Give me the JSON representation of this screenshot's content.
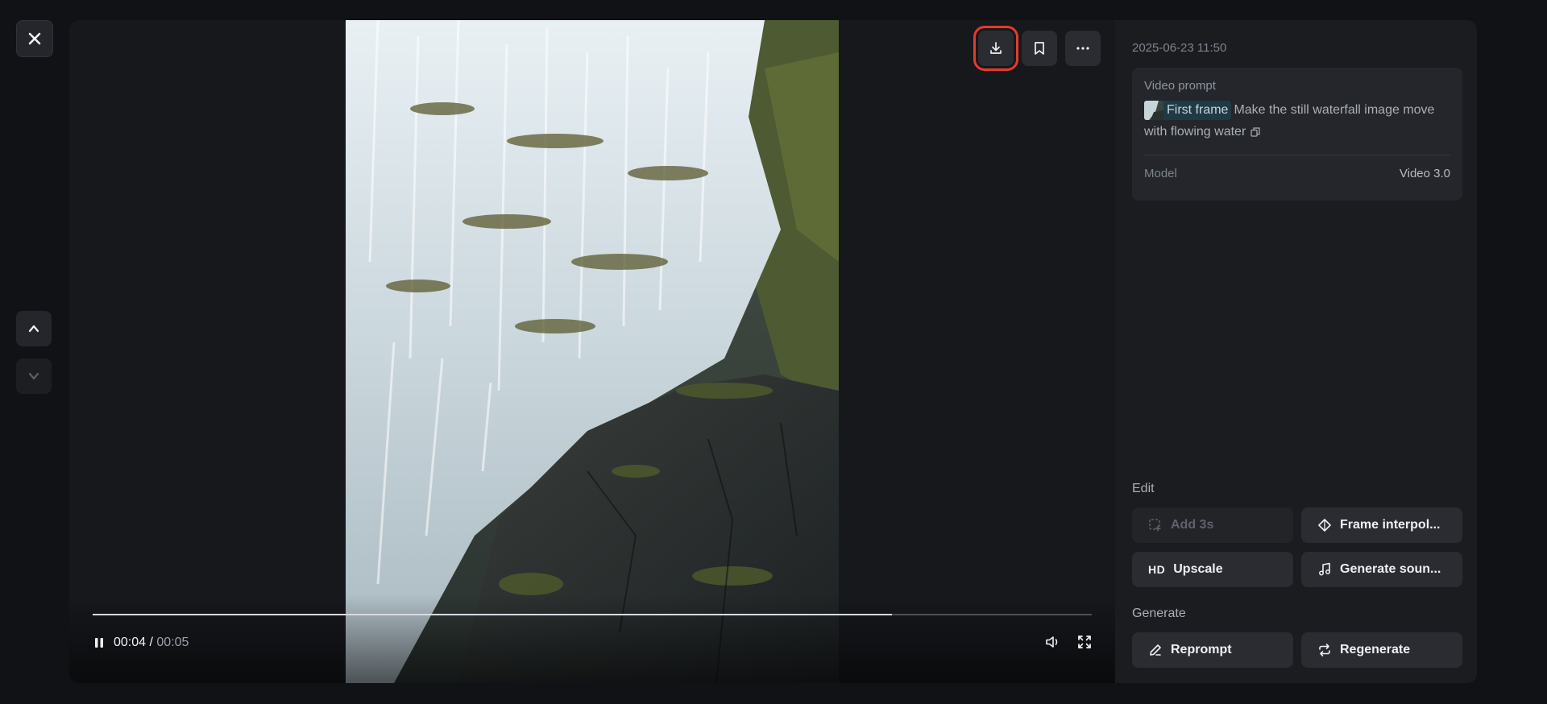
{
  "nav": {
    "close_icon": "close-icon",
    "up_icon": "chevron-up-icon",
    "down_icon": "chevron-down-icon"
  },
  "toolbar": {
    "download_icon": "download-icon",
    "bookmark_icon": "bookmark-icon",
    "more_icon": "more-icon"
  },
  "player": {
    "current_time": "00:04",
    "separator": " / ",
    "total_time": "00:05",
    "progress": 0.8,
    "state": "playing"
  },
  "details": {
    "timestamp": "2025-06-23 11:50",
    "prompt_label": "Video prompt",
    "chip_label": "First frame",
    "prompt_text": "Make the still waterfall image move with flowing water",
    "model_label": "Model",
    "model_value": "Video 3.0"
  },
  "edit": {
    "section_label": "Edit",
    "add_label": "Add 3s",
    "interpolate_label": "Frame interpol...",
    "upscale_prefix": "HD",
    "upscale_label": "Upscale",
    "sound_label": "Generate soun..."
  },
  "generate": {
    "section_label": "Generate",
    "reprompt_label": "Reprompt",
    "regenerate_label": "Regenerate"
  },
  "colors": {
    "background": "#111215",
    "panel": "#1b1c20",
    "highlight": "#e53a2b",
    "chip": "#1f3a44"
  }
}
